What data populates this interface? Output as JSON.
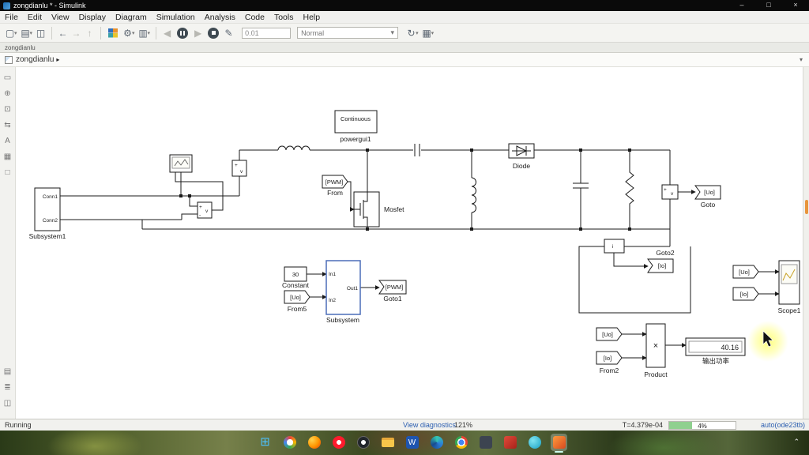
{
  "window": {
    "title": "zongdianlu * - Simulink",
    "minimize": "–",
    "maximize": "□",
    "close": "×"
  },
  "menu": {
    "items": [
      "File",
      "Edit",
      "View",
      "Display",
      "Diagram",
      "Simulation",
      "Analysis",
      "Code",
      "Tools",
      "Help"
    ]
  },
  "toolbar": {
    "sim_time": "0.01",
    "mode": "Normal"
  },
  "tabstrip": {
    "label": "zongdianlu"
  },
  "breadcrumb": {
    "model": "zongdianlu",
    "chevron": "▸",
    "expander": "▾"
  },
  "diagram": {
    "powergui": {
      "title": "Continuous",
      "caption": "powergui1"
    },
    "subsystem1": {
      "port1": "Conn1",
      "port2": "Conn2",
      "caption": "Subsystem1"
    },
    "vm_top": {
      "plus": "+",
      "label": "v"
    },
    "vm_left": {
      "plus": "+",
      "minus": "-",
      "label": "v"
    },
    "from_pwm": {
      "label": "[PWM]",
      "caption": "From"
    },
    "mosfet": {
      "caption": "Mosfet"
    },
    "diode": {
      "caption": "Diode"
    },
    "vm_out": {
      "plus": "+",
      "label": "v"
    },
    "goto_uo": {
      "label": "[Uo]",
      "caption": "Goto"
    },
    "cm": {
      "label": "i"
    },
    "goto2": {
      "label": "[Io]",
      "caption": "Goto2"
    },
    "scope_src_uo": {
      "label": "[Uo]"
    },
    "scope_src_io": {
      "label": "[Io]"
    },
    "scope": {
      "caption": "Scope1"
    },
    "constant": {
      "value": "30",
      "caption": "Constant"
    },
    "from5": {
      "label": "[Uo]",
      "caption": "From5"
    },
    "subsystem": {
      "in1": "In1",
      "in2": "In2",
      "out1": "Out1",
      "caption": "Subsystem"
    },
    "goto1": {
      "label": "[PWM]",
      "caption": "Goto1"
    },
    "pw_uo": {
      "label": "[Uo]"
    },
    "pw_io": {
      "label": "[Io]",
      "caption": "From2"
    },
    "product": {
      "symbol": "×",
      "caption": "Product"
    },
    "display": {
      "value": "40.16",
      "caption": "输出功率"
    }
  },
  "statusbar": {
    "state": "Running",
    "diagnostics": "View diagnostics",
    "zoom": "121%",
    "time": "T=4.379e-04",
    "progress": "4%",
    "solver": "auto(ode23tb)"
  }
}
